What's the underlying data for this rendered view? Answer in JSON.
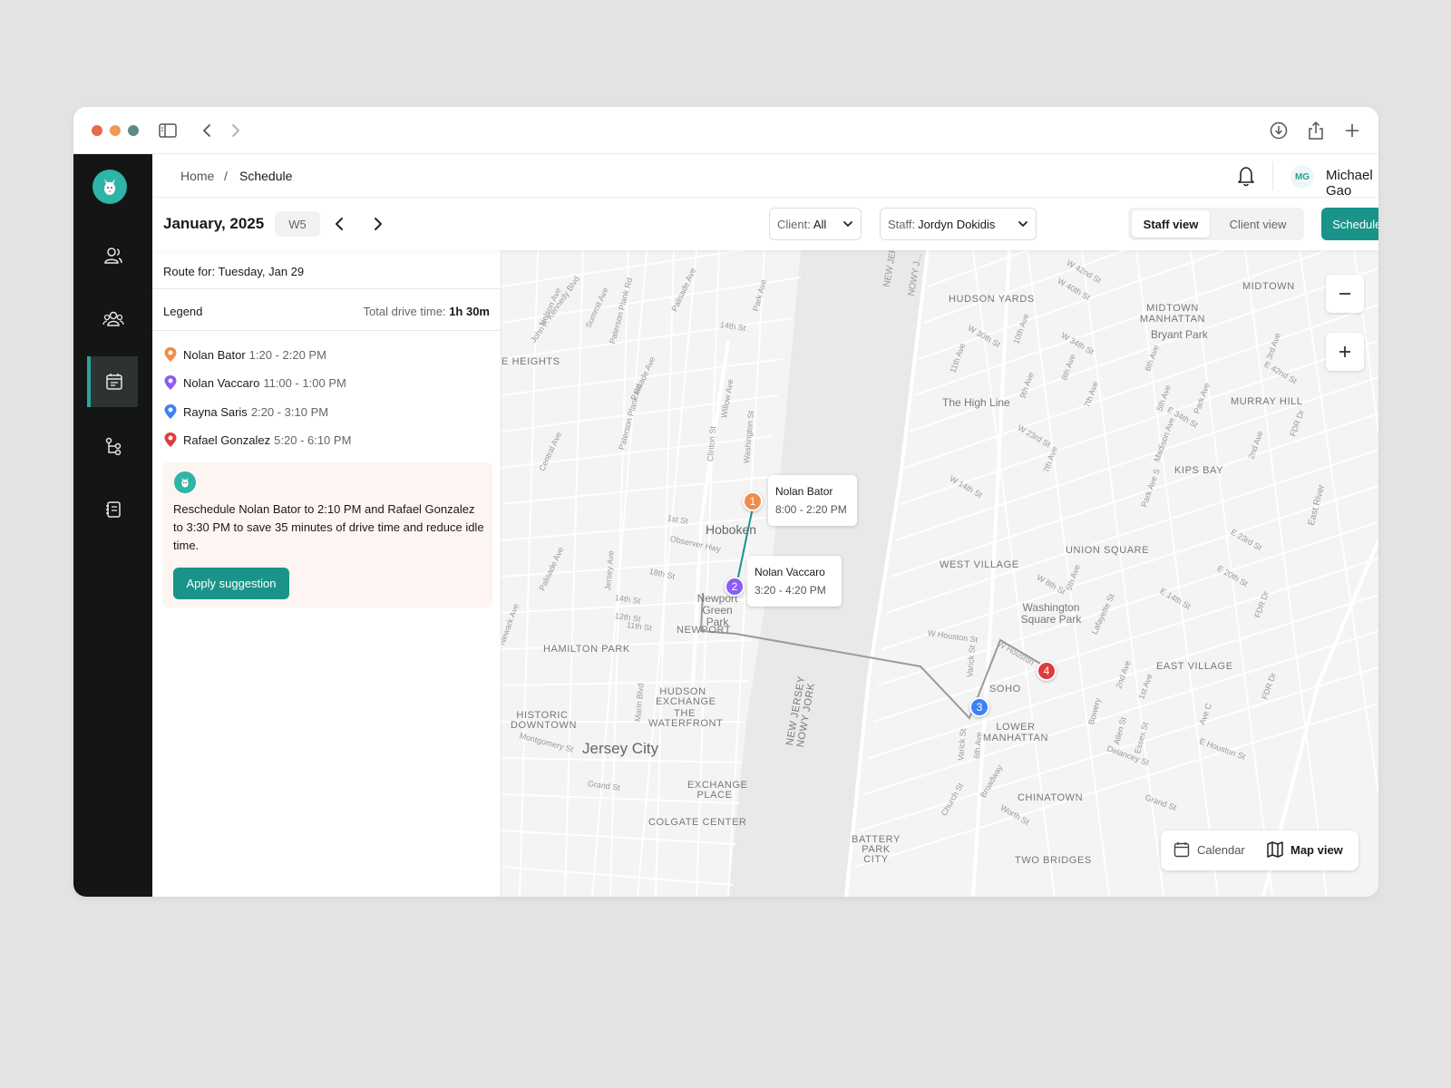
{
  "browser": {
    "icons": [
      "sidebar-toggle-icon",
      "back-icon",
      "forward-icon",
      "download-icon",
      "share-icon",
      "new-tab-icon"
    ]
  },
  "sidebar": {
    "items": [
      {
        "icon": "client-icon",
        "active": false
      },
      {
        "icon": "team-icon",
        "active": false
      },
      {
        "icon": "calendar-icon",
        "active": true
      },
      {
        "icon": "workflow-icon",
        "active": false
      },
      {
        "icon": "notebook-icon",
        "active": false
      }
    ]
  },
  "header": {
    "breadcrumb": {
      "home": "Home",
      "separator": "/",
      "current": "Schedule"
    },
    "user": {
      "initials": "MG",
      "name": "Michael Gao"
    }
  },
  "toolbar": {
    "month": "January, 2025",
    "week": "W5",
    "client_filter": {
      "label": "Client:",
      "value": "All"
    },
    "staff_filter": {
      "label": "Staff:",
      "value": "Jordyn Dokidis"
    },
    "view_toggle": {
      "staff": "Staff view",
      "client": "Client view",
      "selected": "Staff view"
    },
    "schedule_button": "Schedule event"
  },
  "panel": {
    "route_for": "Route for: Tuesday, Jan 29",
    "legend_title": "Legend",
    "drive_label": "Total drive time:",
    "drive_value": "1h 30m",
    "legend": [
      {
        "name": "Nolan Bator",
        "time": "1:20 - 2:20 PM",
        "color": "#f08c4a"
      },
      {
        "name": "Nolan Vaccaro",
        "time": "11:00 - 1:00 PM",
        "color": "#8b5cf6"
      },
      {
        "name": "Rayna Saris",
        "time": "2:20 - 3:10 PM",
        "color": "#3b82f6"
      },
      {
        "name": "Rafael Gonzalez",
        "time": "5:20 - 6:10 PM",
        "color": "#e03c3c"
      }
    ],
    "suggestion": {
      "t1": "Reschedule ",
      "b1": "Nolan Bator",
      "t2": " to ",
      "b2": "2:10 PM",
      "t3": " and ",
      "b3": "Rafael Gonzalez",
      "t4": " to ",
      "b4": "3:30 PM",
      "t5": " to save ",
      "b5": "35 minutes",
      "t6": " of drive time and reduce idle time.",
      "button": "Apply suggestion"
    }
  },
  "map": {
    "markers": [
      {
        "num": "1",
        "color": "#f08c4a"
      },
      {
        "num": "2",
        "color": "#8b5cf6"
      },
      {
        "num": "3",
        "color": "#3b82f6"
      },
      {
        "num": "4",
        "color": "#e03c3c"
      }
    ],
    "tooltips": [
      {
        "name": "Nolan Bator",
        "time": "8:00 - 2:20 PM"
      },
      {
        "name": "Nolan Vaccaro",
        "time": "3:20 - 4:20 PM"
      }
    ],
    "areas": {
      "hudson_yards": "HUDSON YARDS",
      "midtown_manhattan": "MIDTOWN MANHATTAN",
      "midtown": "MIDTOWN",
      "bryant_park": "Bryant Park",
      "murray_hill": "MURRAY HILL",
      "heights": "E HEIGHTS",
      "high_line": "The High Line",
      "kips_bay": "KIPS BAY",
      "union_square": "UNION SQUARE",
      "west_village": "WEST VILLAGE",
      "washington_sq": "Washington Square Park",
      "east_village": "EAST VILLAGE",
      "soho": "SOHO",
      "lower_manhattan": "LOWER MANHATTAN",
      "chinatown": "CHINATOWN",
      "two_bridges": "TWO BRIDGES",
      "battery_park": "BATTERY PARK CITY",
      "hoboken": "Hoboken",
      "newport_green": "Newport Green Park",
      "newport": "NEWPORT",
      "hamilton_park": "HAMILTON PARK",
      "hudson_exchange": "HUDSON EXCHANGE",
      "waterfront": "THE WATERFRONT",
      "historic_downtown": "HISTORIC DOWNTOWN",
      "jersey_city": "Jersey City",
      "exchange_place": "EXCHANGE PLACE",
      "colgate_center": "COLGATE CENTER",
      "nj_ny": "NEW JERSEY NOWY JORK",
      "east_river": "East River"
    },
    "streets": {
      "w42": "W 42nd St",
      "w40": "W 40th St",
      "w30": "W 30th St",
      "w34": "W 34th St",
      "w23": "W 23rd St",
      "w14": "W 14th St",
      "e34": "E 34th St",
      "e42": "E 42nd St",
      "e23": "E 23rd St",
      "e20": "E 20th St",
      "e14": "E 14th St",
      "w8": "W 8th St",
      "whouston": "W Houston St",
      "whouston2": "W Houston",
      "ehouston": "E Houston St",
      "st14": "14th St",
      "st14b": "14th St",
      "st18": "18th St",
      "st1": "1st St",
      "st12": "12th St",
      "st11": "11th St",
      "ave11": "11th Ave",
      "ave10": "10th Ave",
      "ave9": "9th Ave",
      "ave8": "8th Ave",
      "ave7": "7th Ave",
      "ave6": "6th Ave",
      "ave5": "5th Ave",
      "ave3": "3rd Ave",
      "ave2": "2nd Ave",
      "ave1": "1st Ave",
      "avec": "Ave C",
      "parkave": "Park Ave",
      "parkaves": "Park Ave S",
      "madison": "Madison Ave",
      "fdr": "FDR Dr",
      "fdr2": "FDR Dr",
      "fdr3": "FDR Dr",
      "varick": "Varick St",
      "varick2": "Varick St",
      "broadway": "Broadway",
      "bowery": "Bowery",
      "allen": "Allen St",
      "essex": "Essex St",
      "delancey": "Delancey St",
      "lafayette": "Lafayette St",
      "grand": "Grand St",
      "grand2": "Grand St",
      "church": "Church St",
      "worth": "Worth St",
      "observer": "Observer Hwy",
      "palisade": "Palisade Ave",
      "palisade2": "Palisade Ave",
      "palisade3": "Palisade Ave",
      "paterson": "Paterson Plank Rd",
      "paterson2": "Paterson Plank Rd",
      "jfk": "John F. Kennedy Blvd",
      "summit": "Summit Ave",
      "nelson": "Nelson Ave",
      "central": "Central Ave",
      "clinton": "Clinton St",
      "willow": "Willow Ave",
      "washington": "Washington St",
      "jersey": "Jersey Ave",
      "marin": "Marin Blvd",
      "montgomery": "Montgomery St",
      "newark": "Newark Ave",
      "parkave_nj": "Park Ave",
      "newjersey_top": "NEW JERSEY",
      "nowyjork_top": "NOWY J..."
    }
  },
  "view_switch": {
    "calendar": "Calendar",
    "map": "Map view"
  }
}
